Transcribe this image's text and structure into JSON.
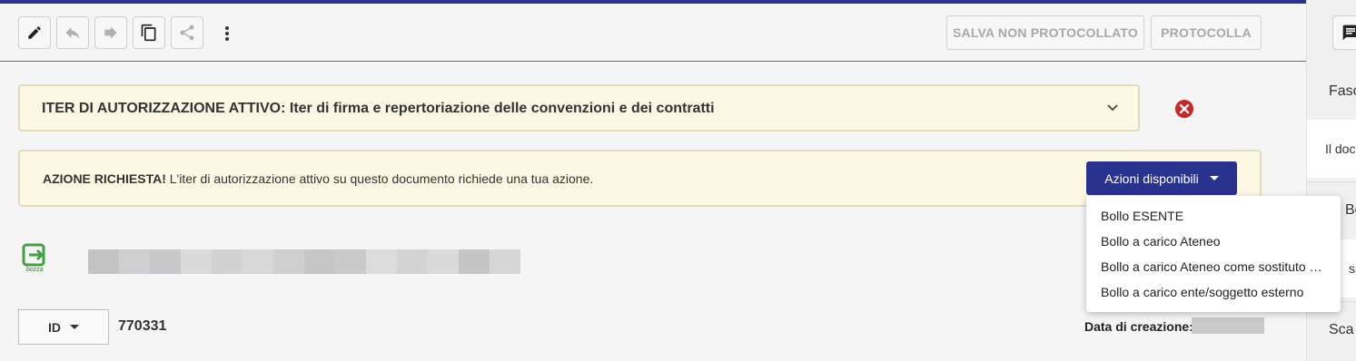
{
  "toolbar": {
    "save_unregistered_label": "SALVA NON PROTOCOLLATO",
    "register_label": "PROTOCOLLA"
  },
  "auth_banner": {
    "title": "ITER DI AUTORIZZAZIONE ATTIVO: Iter di firma e repertoriazione delle convenzioni e dei contratti"
  },
  "action_banner": {
    "strong": "AZIONE RICHIESTA!",
    "text": " L'iter di autorizzazione attivo su questo documento richiede una tua azione.",
    "button_label": "Azioni disponibili"
  },
  "dropdown": {
    "items": [
      "Bollo ESENTE",
      "Bollo a carico Ateneo",
      "Bollo a carico Ateneo come sostituto d'imposta",
      "Bollo a carico ente/soggetto esterno"
    ]
  },
  "doc": {
    "icon_label": "bozza",
    "id_selector_label": "ID",
    "id_value": "770331",
    "creation_date_label": "Data di creazione:"
  },
  "right_panel": {
    "section1": "Fasc",
    "section2": "Il doc",
    "section3": "Boll",
    "section4": "ssu",
    "section5": "Sca"
  },
  "colors": {
    "accent": "#2a3490",
    "banner_bg": "#fcf8e3",
    "close_red": "#c62828"
  }
}
